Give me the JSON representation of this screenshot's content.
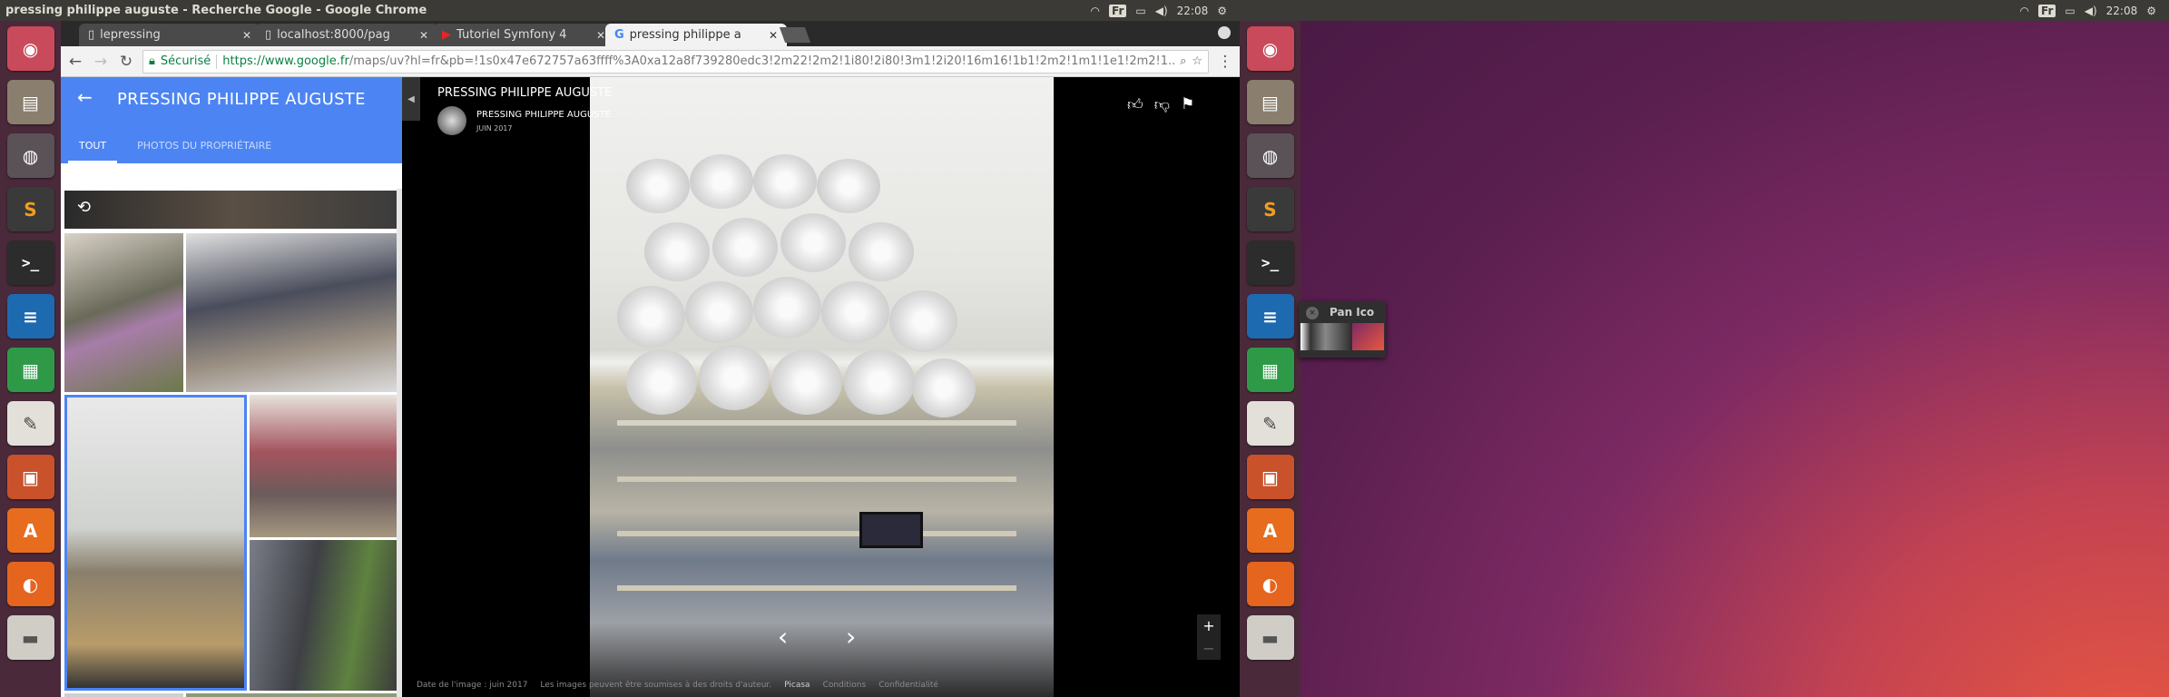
{
  "window": {
    "title": "pressing philippe auguste - Recherche Google - Google Chrome"
  },
  "topbar": {
    "keyboard": "Fr",
    "time": "22:08",
    "icons": [
      "wifi-icon",
      "battery-icon",
      "volume-icon",
      "gear-icon"
    ]
  },
  "launcher": {
    "items": [
      "ubuntu-icon",
      "files-icon",
      "chrome-icon",
      "sublime-icon",
      "terminal-icon",
      "writer-icon",
      "calc-icon",
      "text-editor-icon",
      "impress-icon",
      "software-center-icon",
      "firefox-icon",
      "drive-icon"
    ]
  },
  "tabs": [
    {
      "title": "lepressing",
      "icon": "page-icon"
    },
    {
      "title": "localhost:8000/pag",
      "icon": "page-icon"
    },
    {
      "title": "Tutoriel Symfony 4",
      "icon": "youtube-icon"
    },
    {
      "title": "pressing philippe a",
      "icon": "google-icon",
      "active": true
    }
  ],
  "omnibox": {
    "secure_label": "Sécurisé",
    "url_host": "https://www.google.fr",
    "url_path": "/maps/uv?hl=fr&pb=!1s0x47e672757a63ffff%3A0xa12a8f739280edc3!2m22!2m2!1i80!2i80!3m1!2i20!16m16!1b1!2m2!1m1!1e1!2m2!1..."
  },
  "panel": {
    "title": "PRESSING PHILIPPE AUGUSTE",
    "tabs": [
      "TOUT",
      "PHOTOS DU PROPRIÉTAIRE"
    ],
    "active_tab": "TOUT"
  },
  "viewer": {
    "title": "PRESSING PHILIPPE AUGUSTE",
    "owner": "PRESSING PHILIPPE AUGUSTE",
    "date": "JUIN 2017",
    "zoom_in": "+",
    "zoom_out": "−"
  },
  "footer": {
    "image_date": "Date de l'image : juin 2017",
    "rights": "Les images peuvent être soumises à des droits d'auteur.",
    "brand": "Picasa",
    "terms": "Conditions",
    "privacy": "Confidentialité"
  },
  "popup": {
    "title": "Pan Ico",
    "close": "×"
  }
}
